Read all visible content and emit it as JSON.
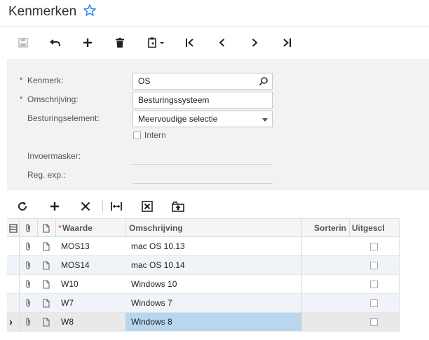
{
  "header": {
    "title": "Kenmerken",
    "favorite_icon": "star-outline-icon"
  },
  "toolbar": {
    "buttons": [
      {
        "name": "save-button",
        "icon": "save-icon",
        "enabled": false
      },
      {
        "name": "undo-button",
        "icon": "undo-icon"
      },
      {
        "name": "add-button",
        "icon": "plus-icon"
      },
      {
        "name": "delete-button",
        "icon": "trash-icon"
      },
      {
        "name": "clipboard-menu-button",
        "icon": "clipboard-icon"
      },
      {
        "name": "first-record-button",
        "icon": "first-icon"
      },
      {
        "name": "previous-record-button",
        "icon": "prev-icon"
      },
      {
        "name": "next-record-button",
        "icon": "next-icon"
      },
      {
        "name": "last-record-button",
        "icon": "last-icon"
      }
    ]
  },
  "form": {
    "kenmerk_label": "Kenmerk:",
    "kenmerk_value": "OS",
    "omschrijving_label": "Omschrijving:",
    "omschrijving_value": "Besturingssysteem",
    "besturingselement_label": "Besturingselement:",
    "besturingselement_value": "Meervoudige selectie",
    "intern_label": "Intern",
    "invoermasker_label": "Invoermasker:",
    "regexp_label": "Reg. exp.:",
    "required_mark": "*"
  },
  "grid": {
    "columns": {
      "waarde": "Waarde",
      "omschrijving": "Omschrijving",
      "sorterin": "Sorterin",
      "uitgescl": "Uitgescl"
    },
    "required_mark": "*",
    "rows": [
      {
        "waarde": "MOS13",
        "omschrijving": "mac OS 10.13",
        "uitgescl": false
      },
      {
        "waarde": "MOS14",
        "omschrijving": "mac OS 10.14",
        "uitgescl": false
      },
      {
        "waarde": "W10",
        "omschrijving": "Windows 10",
        "uitgescl": false
      },
      {
        "waarde": "W7",
        "omschrijving": "Windows 7",
        "uitgescl": false
      },
      {
        "waarde": "W8",
        "omschrijving": "Windows 8",
        "uitgescl": false,
        "selected": true
      }
    ],
    "current_row_marker": "›",
    "selection_color": "#b8d6ee"
  }
}
